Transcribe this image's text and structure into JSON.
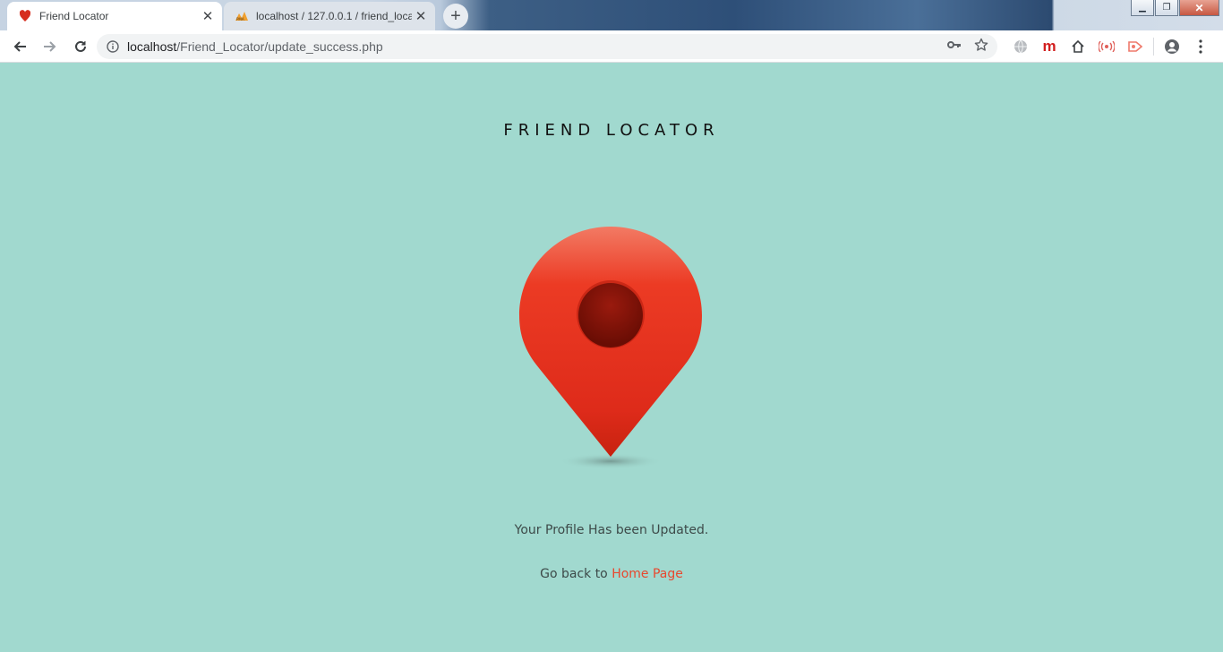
{
  "browser": {
    "tabs": [
      {
        "title": "Friend Locator",
        "active": true
      },
      {
        "title": "localhost / 127.0.0.1 / friend_loca",
        "active": false
      }
    ],
    "address": {
      "host": "localhost",
      "path": "/Friend_Locator/update_success.php"
    },
    "window_buttons": [
      "minimize",
      "restore",
      "close"
    ]
  },
  "page": {
    "title": "FRIEND LOCATOR",
    "message": "Your Profile Has been Updated.",
    "goback_prefix": "Go back to ",
    "goback_link": "Home Page"
  },
  "colors": {
    "background": "#a1d9cf",
    "pin_red": "#e8301c",
    "pin_dark": "#7d1308",
    "link": "#e8482e"
  }
}
